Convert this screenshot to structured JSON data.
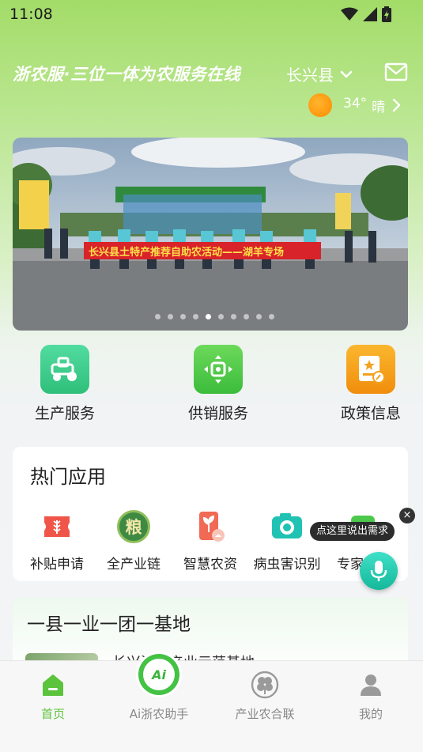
{
  "status_bar": {
    "time": "11:08",
    "icons": [
      "wifi-icon",
      "signal-icon",
      "battery-icon"
    ]
  },
  "header": {
    "title": "浙农服·三位一体为农服务在线",
    "county": "长兴县",
    "icons": [
      "chevron-down-icon",
      "mail-icon"
    ]
  },
  "weather": {
    "temperature": "34°",
    "condition": "晴",
    "icons": [
      "sun-icon",
      "chevron-right-icon"
    ]
  },
  "banner": {
    "banner_text": "长兴县土特产推荐自助农活动——湖羊专场",
    "slide_count": 10,
    "active_slide": 4
  },
  "services": [
    {
      "label": "生产服务",
      "icon": "tractor-icon",
      "color": "#3ecf8a"
    },
    {
      "label": "供销服务",
      "icon": "exchange-icon",
      "color": "#4cc94c"
    },
    {
      "label": "政策信息",
      "icon": "policy-doc-icon",
      "color": "#f9a31c"
    }
  ],
  "hot_apps": {
    "title": "热门应用",
    "items": [
      {
        "label": "补贴申请",
        "icon": "wheat-ticket-icon"
      },
      {
        "label": "全产业链",
        "icon": "grain-badge-icon",
        "badge_text": "粮"
      },
      {
        "label": "智慧农资",
        "icon": "seedling-bag-icon"
      },
      {
        "label": "病虫害识别",
        "icon": "camera-icon"
      },
      {
        "label": "专家问答",
        "icon": "chat-icon"
      }
    ]
  },
  "voice_assist": {
    "tooltip": "点这里说出需求",
    "close_symbol": "×"
  },
  "base_section": {
    "title": "一县一业一团一基地",
    "item_name": "长兴湖羊产业示范基地"
  },
  "tabbar": [
    {
      "label": "首页",
      "icon": "home-icon",
      "active": true
    },
    {
      "label": "Ai浙农助手",
      "icon": "ai-assistant-icon",
      "badge": "Ai",
      "active": false
    },
    {
      "label": "产业农合联",
      "icon": "clover-icon",
      "active": false
    },
    {
      "label": "我的",
      "icon": "user-icon",
      "active": false
    }
  ],
  "colors": {
    "accent": "#5cc33c",
    "header_green": "#a3dc68",
    "mic": "#1fc4a6"
  }
}
